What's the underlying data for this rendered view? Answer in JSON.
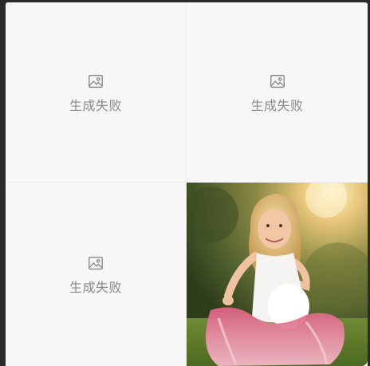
{
  "gallery": {
    "items": [
      {
        "status": "failed",
        "label": "生成失败",
        "icon": "broken-image-icon"
      },
      {
        "status": "failed",
        "label": "生成失败",
        "icon": "broken-image-icon"
      },
      {
        "status": "failed",
        "label": "生成失败",
        "icon": "broken-image-icon"
      },
      {
        "status": "success",
        "alt": "",
        "watermark": ""
      }
    ]
  },
  "colors": {
    "cell_bg": "#f7f7f7",
    "label": "#8a8a8a",
    "frame": "#2b2b2b"
  }
}
